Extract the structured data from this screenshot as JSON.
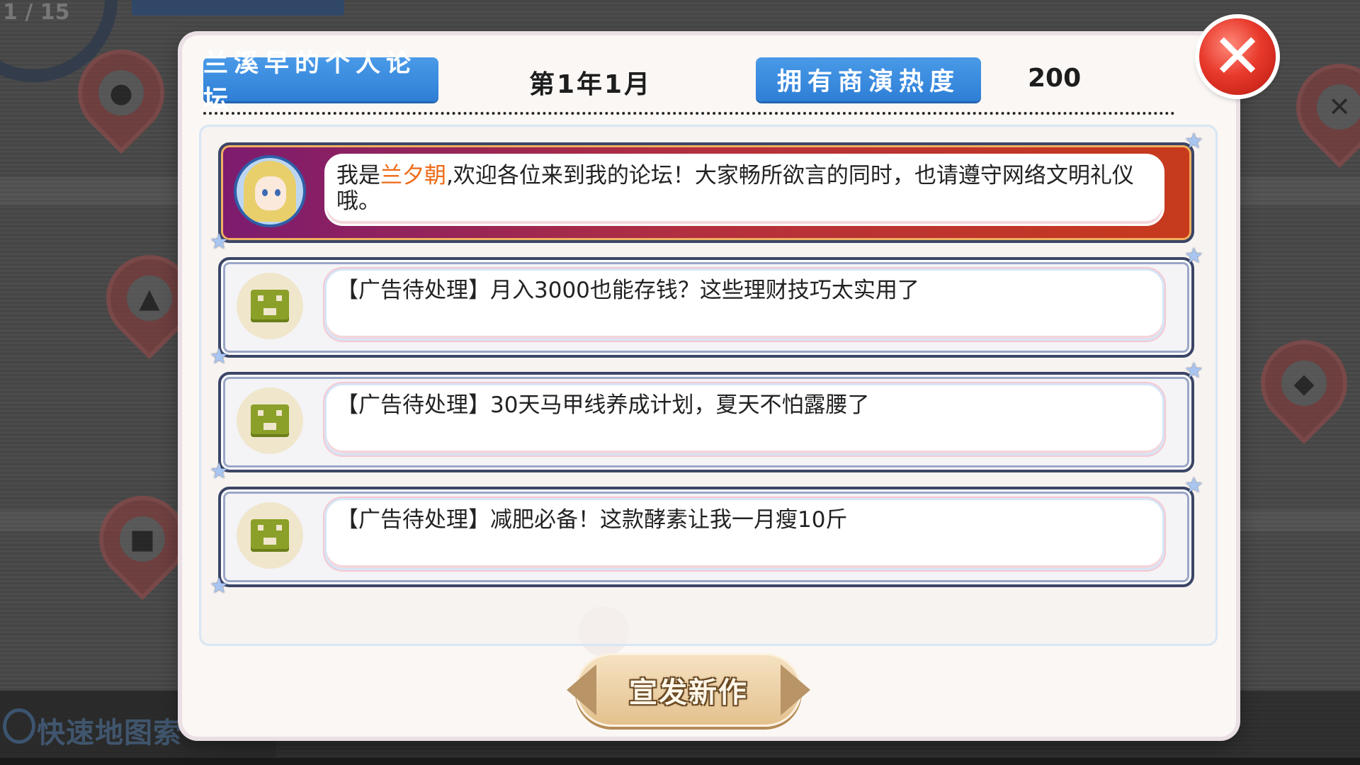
{
  "background": {
    "counter": "1 / 15",
    "quick_map_label": "快速地图索"
  },
  "header": {
    "forum_title": "兰溪早的个人论坛",
    "date": "第1年1月",
    "popularity_label": "拥有商演热度",
    "popularity_value": "200"
  },
  "owner_post": {
    "prefix": "我是",
    "owner_name": "兰夕朝",
    "message": ",欢迎各位来到我的论坛！大家畅所欲言的同时，也请遵守网络文明礼仪哦。"
  },
  "posts": [
    {
      "text": "【广告待处理】月入3000也能存钱？这些理财技巧太实用了",
      "icon": "shop-icon"
    },
    {
      "text": "【广告待处理】30天马甲线养成计划，夏天不怕露腰了",
      "icon": "shop-icon"
    },
    {
      "text": "【广告待处理】减肥必备！这款酵素让我一月瘦10斤",
      "icon": "shop-icon"
    }
  ],
  "buttons": {
    "publish_label": "宣发新作",
    "close_label": "✕"
  },
  "colors": {
    "accent_blue": "#2e7ed6",
    "owner_name": "#ee6a16",
    "close_red": "#e83a2c"
  }
}
